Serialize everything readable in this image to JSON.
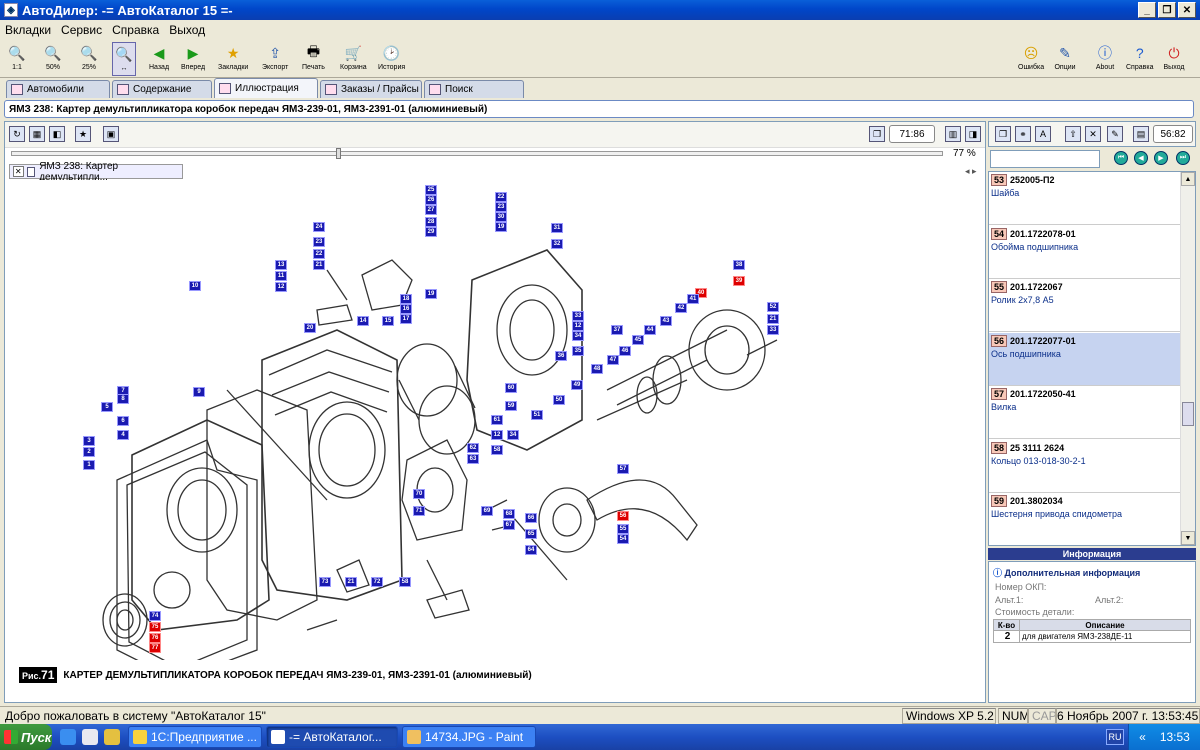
{
  "window": {
    "title": "АвтоДилер: -= АвтоКаталог 15 =-"
  },
  "menu": [
    "Вкладки",
    "Сервис",
    "Справка",
    "Выход"
  ],
  "toolbar": {
    "zoom": [
      "1:1",
      "50%",
      "25%",
      ""
    ],
    "left": [
      "Назад",
      "Вперед",
      "Закладки",
      "Экспорт",
      "Печать",
      "Корзина",
      "История"
    ],
    "right": [
      "Ошибка",
      "Опции",
      "About",
      "Справка",
      "Выход"
    ]
  },
  "tabs": [
    "Автомобили",
    "Содержание",
    "Иллюстрация",
    "Заказы / Прайсы",
    "Поиск"
  ],
  "active_tab": "Иллюстрация",
  "header": "ЯМЗ 238: Картер демультипликатора коробок передач ЯМЗ-239-01, ЯМЗ-2391-01 (алюминиевый)",
  "illustration": {
    "counter": "71:86",
    "zoom_percent": "77 %",
    "zoom_level": 0.35,
    "doc_tab": "ЯМЗ 238: Картер демультипли...",
    "nav_arrows": "◂ ▸",
    "figure_label": "Рис.",
    "figure_no": "71",
    "figure_caption": "КАРТЕР ДЕМУЛЬТИПЛИКАТОРА КОРОБОК ПЕРЕДАЧ ЯМЗ-239-01, ЯМЗ-2391-01 (алюминиевый)",
    "callouts": [
      "25",
      "26",
      "27",
      "28",
      "29",
      "22",
      "23",
      "30",
      "19",
      "24",
      "23",
      "22",
      "21",
      "13",
      "11",
      "12",
      "10",
      "18",
      "16",
      "17",
      "15",
      "14",
      "20",
      "19",
      "31",
      "32",
      "33",
      "12",
      "34",
      "35",
      "36",
      "38",
      "39",
      "40",
      "41",
      "42",
      "43",
      "44",
      "45",
      "46",
      "47",
      "48",
      "49",
      "50",
      "51",
      "52",
      "21",
      "33",
      "37",
      "60",
      "59",
      "61",
      "12",
      "34",
      "58",
      "62",
      "63",
      "7",
      "8",
      "5",
      "6",
      "4",
      "3",
      "2",
      "1",
      "9",
      "70",
      "71",
      "69",
      "68",
      "67",
      "66",
      "65",
      "64",
      "57",
      "56",
      "55",
      "54",
      "73",
      "21",
      "72",
      "58",
      "74",
      "75",
      "76",
      "77"
    ],
    "callout_red": [
      "41",
      "40",
      "56",
      "74",
      "75",
      "76",
      "77"
    ]
  },
  "parts_panel": {
    "counter": "56:82",
    "items": [
      {
        "no": "53",
        "code": "252005-П2",
        "name": "Шайба"
      },
      {
        "no": "54",
        "code": "201.1722078-01",
        "name": "Обойма подшипника"
      },
      {
        "no": "55",
        "code": "201.1722067",
        "name": "Ролик 2х7,8 А5"
      },
      {
        "no": "56",
        "code": "201.1722077-01",
        "name": "Ось подшипника"
      },
      {
        "no": "57",
        "code": "201.1722050-41",
        "name": "Вилка"
      },
      {
        "no": "58",
        "code": "25 3111 2624",
        "name": "Кольцо 013-018-30-2-1"
      },
      {
        "no": "59",
        "code": "201.3802034",
        "name": "Шестерня привода спидометра"
      }
    ],
    "selected": "56"
  },
  "info": {
    "title": "Информация",
    "subtitle": "Дополнительная информация",
    "okp": "Номер ОКП:",
    "alt1": "Альт.1:",
    "alt2": "Альт.2:",
    "cost": "Стоимость детали:",
    "table_headers": [
      "К-во",
      "Описание"
    ],
    "rows": [
      {
        "qty": "2",
        "desc": "для двигателя ЯМЗ-238ДЕ-11"
      }
    ]
  },
  "status": {
    "message": "Добро пожаловать в систему \"АвтоКаталог 15\"",
    "os": "Windows XP 5.2",
    "num": "NUM",
    "caps": "CAPS",
    "datetime": "6 Ноябрь 2007 г. 13:53:45"
  },
  "taskbar": {
    "start": "Пуск",
    "tasks": [
      "1С:Предприятие ...",
      "-= АвтоКаталог...",
      "14734.JPG - Paint"
    ],
    "lang": "RU",
    "clock": "13:53"
  }
}
